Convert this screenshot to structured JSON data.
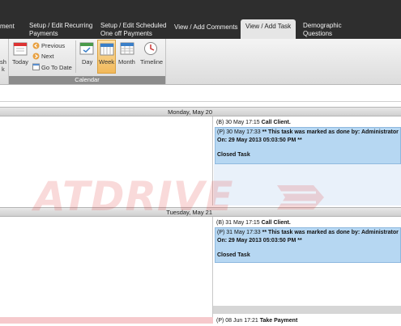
{
  "tabs": [
    {
      "label": "ment"
    },
    {
      "label": "Setup / Edit Recurring\nPayments"
    },
    {
      "label": "Setup / Edit Scheduled\nOne off Payments"
    },
    {
      "label": "View / Add Comments"
    },
    {
      "label": "View / Add Task",
      "active": true
    },
    {
      "label": "Demographic\nQuestions"
    }
  ],
  "ribbon": {
    "left_fragment": {
      "line1": "sh",
      "line2": "k"
    },
    "today_label": "Today",
    "previous_label": "Previous",
    "next_label": "Next",
    "goto_label": "Go To Date",
    "views": {
      "day": "Day",
      "week": "Week",
      "month": "Month",
      "timeline": "Timeline"
    },
    "calendar_group_label": "Calendar"
  },
  "scheduler": {
    "days": [
      {
        "header": "Monday, May 20",
        "appointments": [
          {
            "prefix": "(B) 30 May 17:15",
            "title": "Call Client."
          },
          {
            "prefix": "(P) 30 May 17:33",
            "title": "** This task was marked as done by: Administrator",
            "line2": "On: 29 May 2013 05:03:50 PM **",
            "line3": "Closed Task"
          }
        ]
      },
      {
        "header": "Tuesday, May 21",
        "appointments": [
          {
            "prefix": "(B) 31 May 17:15",
            "title": "Call Client."
          },
          {
            "prefix": "(P) 31 May 17:33",
            "title": "** This task was marked as done by: Administrator",
            "line2": "On: 29 May 2013 05:03:50 PM **",
            "line3": "Closed Task"
          },
          {
            "prefix": "(P) 08 Jun 17:21",
            "title": "Take Payment"
          }
        ]
      }
    ]
  },
  "watermark": {
    "text": "ATDRIVE"
  },
  "colors": {
    "tabbar": "#2e2e2e",
    "done_task": "#b6d7f2",
    "active_view": "#f6c872",
    "left_pink": "#f6c9cc",
    "watermark": "#e23a3a"
  }
}
